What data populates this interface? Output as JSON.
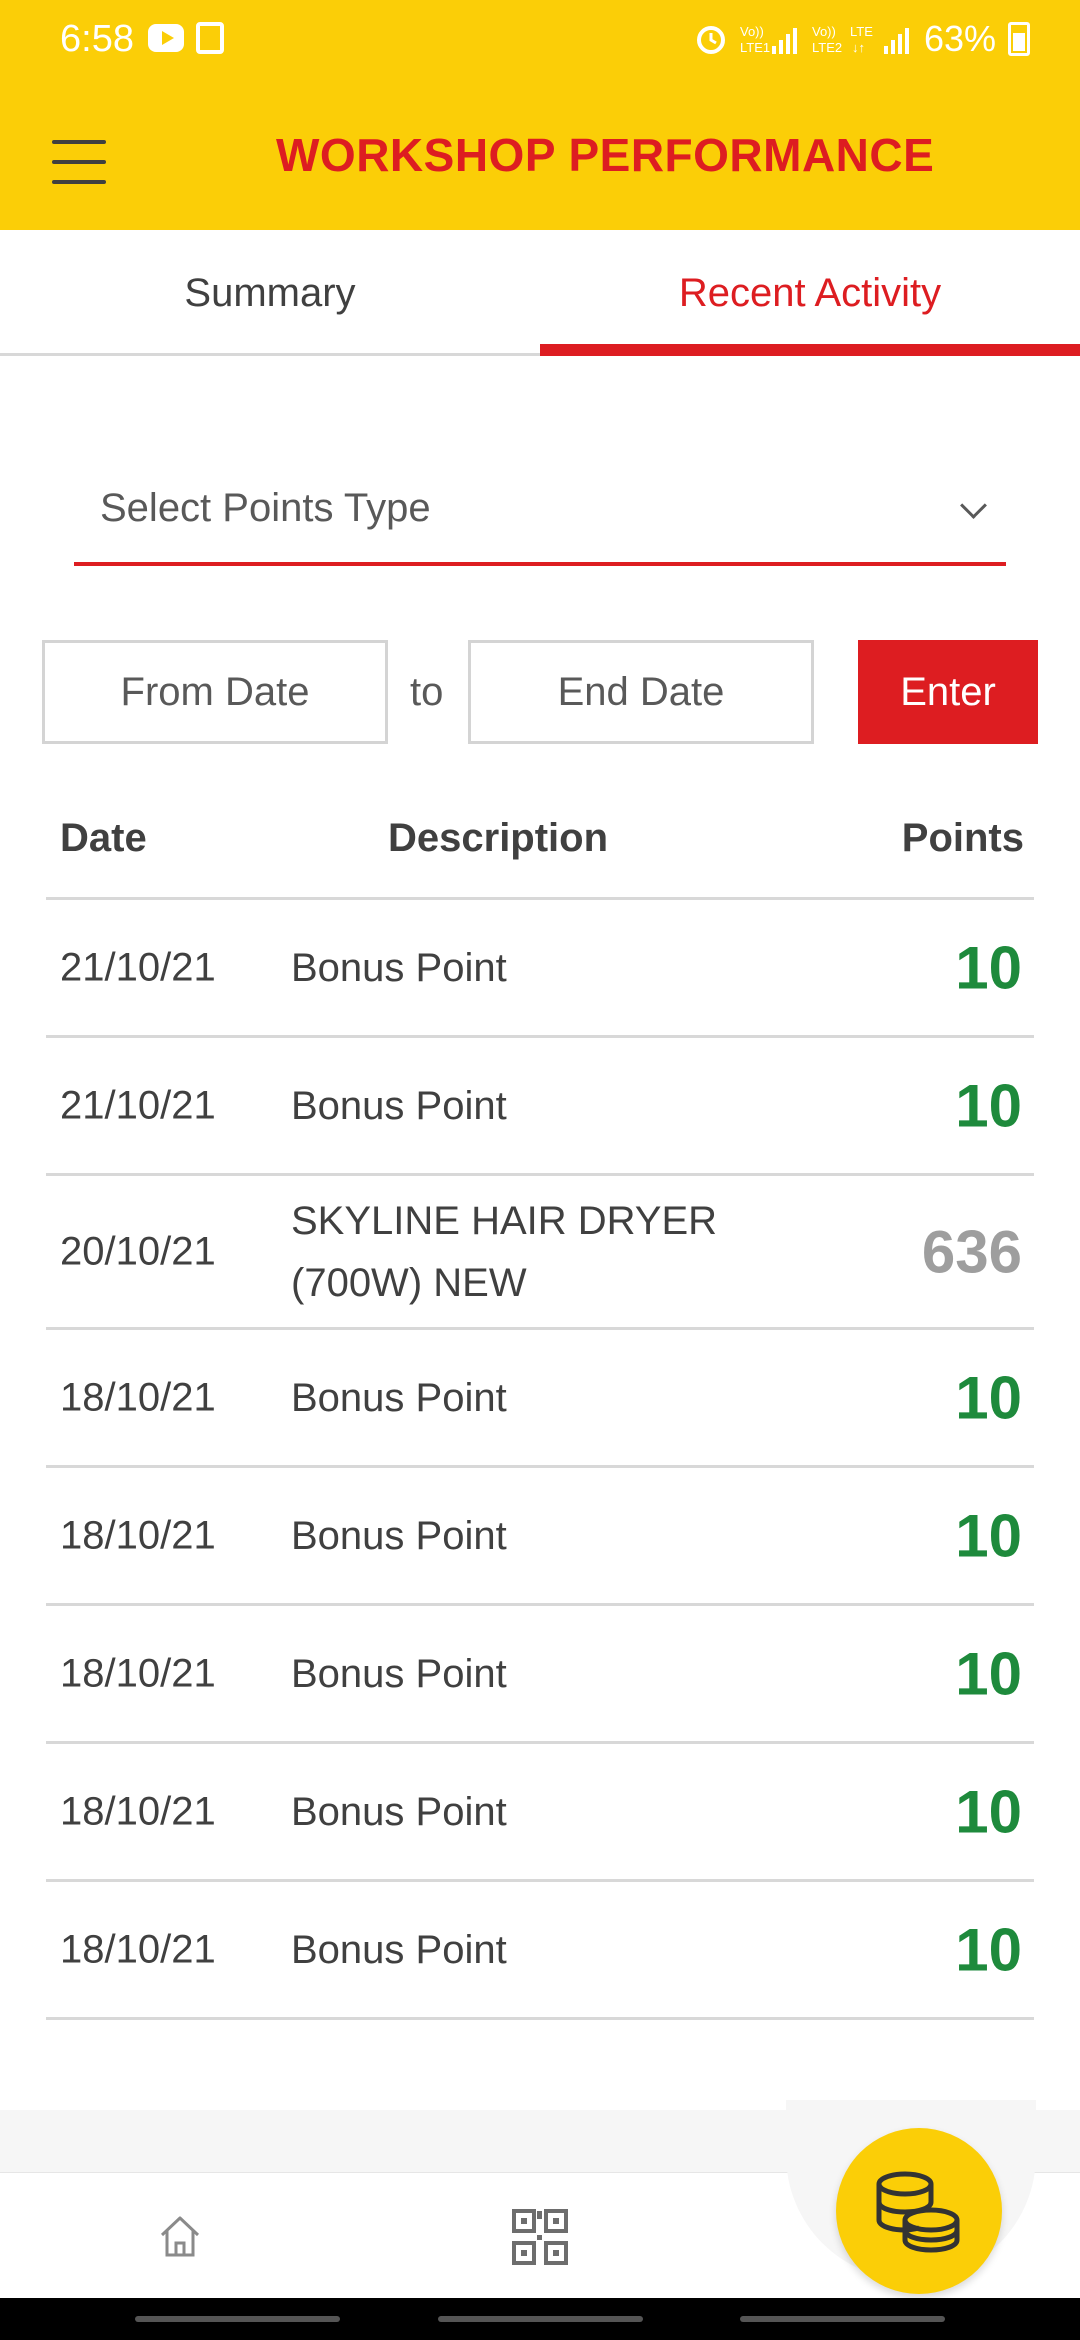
{
  "status_bar": {
    "time": "6:58",
    "battery": "63%"
  },
  "header": {
    "title": "WORKSHOP PERFORMANCE"
  },
  "tabs": [
    {
      "label": "Summary",
      "active": false
    },
    {
      "label": "Recent Activity",
      "active": true
    }
  ],
  "filters": {
    "points_type_placeholder": "Select Points Type",
    "from_date_placeholder": "From Date",
    "to_label": "to",
    "end_date_placeholder": "End Date",
    "enter_label": "Enter"
  },
  "table": {
    "headers": {
      "date": "Date",
      "description": "Description",
      "points": "Points"
    },
    "rows": [
      {
        "date": "21/10/21",
        "description": "Bonus Point",
        "points": "10",
        "color": "#1E8A3C"
      },
      {
        "date": "21/10/21",
        "description": "Bonus Point",
        "points": "10",
        "color": "#1E8A3C"
      },
      {
        "date": "20/10/21",
        "description": "SKYLINE HAIR DRYER (700W) NEW",
        "points": "636",
        "color": "#9E9E9E"
      },
      {
        "date": "18/10/21",
        "description": "Bonus Point",
        "points": "10",
        "color": "#1E8A3C"
      },
      {
        "date": "18/10/21",
        "description": "Bonus Point",
        "points": "10",
        "color": "#1E8A3C"
      },
      {
        "date": "18/10/21",
        "description": "Bonus Point",
        "points": "10",
        "color": "#1E8A3C"
      },
      {
        "date": "18/10/21",
        "description": "Bonus Point",
        "points": "10",
        "color": "#1E8A3C"
      },
      {
        "date": "18/10/21",
        "description": "Bonus Point",
        "points": "10",
        "color": "#1E8A3C"
      }
    ]
  },
  "bottom_nav": {
    "items": [
      {
        "icon": "home-icon"
      },
      {
        "icon": "qr-code-icon"
      },
      {
        "icon": "coins-icon"
      }
    ]
  },
  "colors": {
    "brand_yellow": "#FBCE07",
    "brand_red": "#DD1D21",
    "positive_green": "#1E8A3C",
    "redeemed_grey": "#9E9E9E"
  }
}
